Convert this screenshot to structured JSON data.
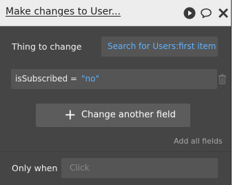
{
  "header": {
    "title": "Make changes to User...",
    "icons": [
      "play-icon",
      "comment-icon",
      "close-icon"
    ]
  },
  "thing": {
    "label": "Thing to change",
    "value": "Search for Users:first item"
  },
  "fields": [
    {
      "name": "isSubscribed",
      "operator": "=",
      "value": "\"no\""
    }
  ],
  "actions": {
    "change_another_label": "Change another field",
    "add_all_label": "Add all fields"
  },
  "condition": {
    "label": "Only when",
    "placeholder": "Click"
  },
  "colors": {
    "panel_bg": "#454545",
    "header_bg": "#ededed",
    "dynamic_text": "#5fb3ff"
  }
}
